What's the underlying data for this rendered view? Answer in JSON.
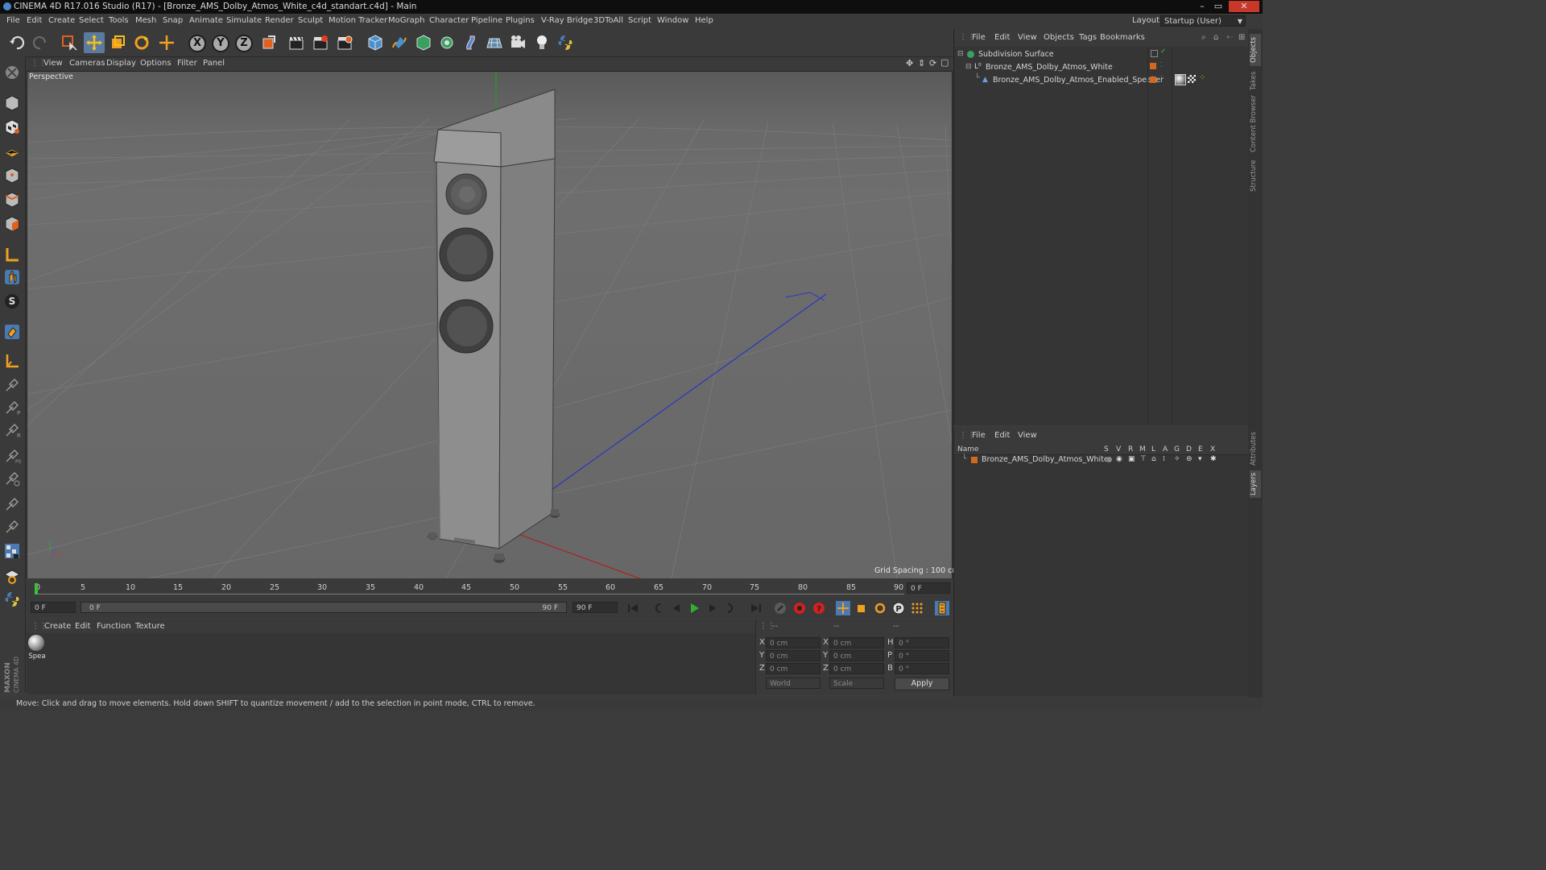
{
  "window": {
    "title": "CINEMA 4D R17.016 Studio (R17) - [Bronze_AMS_Dolby_Atmos_White_c4d_standart.c4d] - Main",
    "controls": [
      "–",
      "▭",
      "✕"
    ]
  },
  "menubar": {
    "items": [
      "File",
      "Edit",
      "Create",
      "Select",
      "Tools",
      "Mesh",
      "Snap",
      "Animate",
      "Simulate",
      "Render",
      "Sculpt",
      "Motion Tracker",
      "MoGraph",
      "Character",
      "Pipeline",
      "Plugins",
      "V-Ray Bridge",
      "3DToAll",
      "Script",
      "Window",
      "Help"
    ],
    "layout_label": "Layout:",
    "layout_value": "Startup (User)"
  },
  "toolbar": {
    "axis_x": "X",
    "axis_y": "Y",
    "axis_z": "Z"
  },
  "viewport": {
    "menu": [
      "View",
      "Cameras",
      "Display",
      "Options",
      "Filter",
      "Panel"
    ],
    "label": "Perspective",
    "grid_spacing": "Grid Spacing : 100 cm"
  },
  "timeline": {
    "ticks": [
      "0",
      "5",
      "10",
      "15",
      "20",
      "25",
      "30",
      "35",
      "40",
      "45",
      "50",
      "55",
      "60",
      "65",
      "70",
      "75",
      "80",
      "85",
      "90"
    ],
    "current_frame": "0 F"
  },
  "transport": {
    "start_field": "0 F",
    "range_start": "0 F",
    "range_end": "90 F",
    "end_field": "90 F"
  },
  "material_panel": {
    "menu": [
      "Create",
      "Edit",
      "Function",
      "Texture"
    ],
    "material_label": "Spea"
  },
  "coordinates": {
    "header": [
      "--",
      "--",
      "--"
    ],
    "rows": [
      {
        "a": "X",
        "av": "0 cm",
        "b": "X",
        "bv": "0 cm",
        "c": "H",
        "cv": "0 °"
      },
      {
        "a": "Y",
        "av": "0 cm",
        "b": "Y",
        "bv": "0 cm",
        "c": "P",
        "cv": "0 °"
      },
      {
        "a": "Z",
        "av": "0 cm",
        "b": "Z",
        "bv": "0 cm",
        "c": "B",
        "cv": "0 °"
      }
    ],
    "world": "World",
    "scale": "Scale",
    "apply": "Apply"
  },
  "object_manager": {
    "menu": [
      "File",
      "Edit",
      "View",
      "Objects",
      "Tags",
      "Bookmarks"
    ],
    "objects": [
      {
        "name": "Subdivision Surface",
        "level": 0
      },
      {
        "name": "Bronze_AMS_Dolby_Atmos_White",
        "level": 1
      },
      {
        "name": "Bronze_AMS_Dolby_Atmos_Enabled_Speaker",
        "level": 2
      }
    ]
  },
  "layer_manager": {
    "menu": [
      "File",
      "Edit",
      "View"
    ],
    "name_header": "Name",
    "columns": [
      "S",
      "V",
      "R",
      "M",
      "L",
      "A",
      "G",
      "D",
      "E",
      "X"
    ],
    "layers": [
      {
        "name": "Bronze_AMS_Dolby_Atmos_White"
      }
    ]
  },
  "side_tabs": [
    "Objects",
    "Takes",
    "Content Browser",
    "Structure",
    "Attributes",
    "Layers"
  ],
  "status": {
    "text": "Move: Click and drag to move elements. Hold down SHIFT to quantize movement / add to the selection in point mode, CTRL to remove."
  },
  "branding": "MAXON CINEMA 4D",
  "colors": {
    "accent": "#4a86c8",
    "layer_color": "#d2691e",
    "axis_x": "#cc3322",
    "axis_y": "#33aa33",
    "axis_z": "#3344cc"
  }
}
